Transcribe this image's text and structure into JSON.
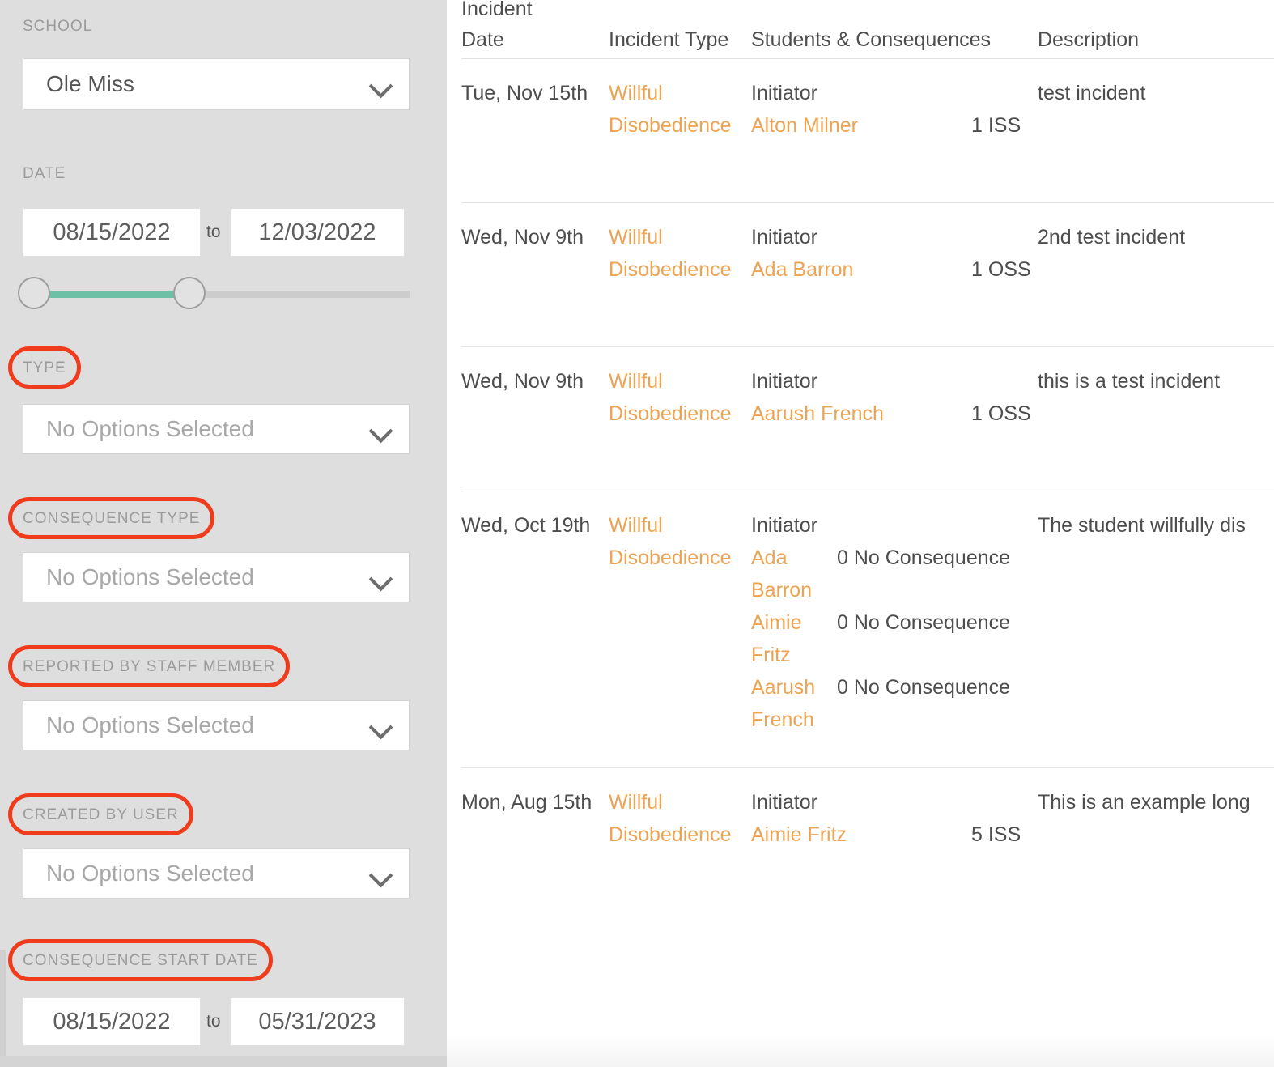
{
  "sidebar": {
    "school": {
      "label": "SCHOOL",
      "value": "Ole Miss",
      "chevron_icon": "chevron-down-icon"
    },
    "date": {
      "label": "DATE",
      "from": "08/15/2022",
      "to_word": "to",
      "to": "12/03/2022",
      "slider": {
        "fill_color": "#6dbfa5",
        "track_color": "#cccccc"
      }
    },
    "type": {
      "label": "TYPE",
      "value": "No Options Selected",
      "annotated": true
    },
    "consequence_type": {
      "label": "CONSEQUENCE TYPE",
      "value": "No Options Selected",
      "annotated": true
    },
    "reported_by_staff_member": {
      "label": "REPORTED BY STAFF MEMBER",
      "value": "No Options Selected",
      "annotated": true
    },
    "created_by_user": {
      "label": "CREATED BY USER",
      "value": "No Options Selected",
      "annotated": true
    },
    "consequence_start_date": {
      "label": "CONSEQUENCE START DATE",
      "from": "08/15/2022",
      "to_word": "to",
      "to": "05/31/2023",
      "annotated": true
    }
  },
  "annotation": {
    "color": "#ee3c1d",
    "shape": "rounded-rectangle-highlight"
  },
  "colors": {
    "sidebar_bg": "#dedede",
    "link_orange": "#eda351",
    "text_gray": "#4d4d4d",
    "label_gray": "#9b9b9b",
    "accent_teal": "#6dbfa5",
    "annotation_red": "#ee3c1d"
  },
  "table": {
    "headers": {
      "incident_date": "Incident\nDate",
      "incident_type": "Incident Type",
      "students_consequences": "Students & Consequences",
      "description": "Description"
    },
    "rows": [
      {
        "date": "Tue, Nov\n15th",
        "type": "Willful\nDisobedience",
        "role": "Initiator",
        "students": [
          {
            "name": "Alton Milner",
            "consequence": "1 ISS"
          }
        ],
        "description": "test incident"
      },
      {
        "date": "Wed, Nov\n9th",
        "type": "Willful\nDisobedience",
        "role": "Initiator",
        "students": [
          {
            "name": "Ada Barron",
            "consequence": "1 OSS"
          }
        ],
        "description": "2nd test incident"
      },
      {
        "date": "Wed, Nov\n9th",
        "type": "Willful\nDisobedience",
        "role": "Initiator",
        "students": [
          {
            "name": "Aarush French",
            "consequence": "1 OSS"
          }
        ],
        "description": "this is a test incident"
      },
      {
        "date": "Wed, Oct\n19th",
        "type": "Willful\nDisobedience",
        "role": "Initiator",
        "students": [
          {
            "name": "Ada Barron",
            "consequence": "0 No Consequence"
          },
          {
            "name": "Aimie Fritz",
            "consequence": "0 No Consequence"
          },
          {
            "name": "Aarush French",
            "consequence": "0 No Consequence"
          }
        ],
        "description": "The student willfully dis"
      },
      {
        "date": "Mon, Aug\n15th",
        "type": "Willful\nDisobedience",
        "role": "Initiator",
        "students": [
          {
            "name": "Aimie Fritz",
            "consequence": "5 ISS"
          }
        ],
        "description": "This is an example long"
      }
    ]
  }
}
